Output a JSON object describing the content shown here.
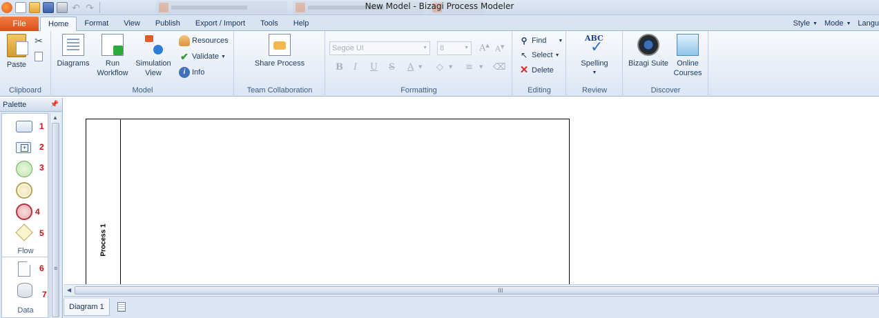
{
  "window": {
    "title": "New Model - Bizagi Process Modeler"
  },
  "menu": {
    "file": "File",
    "tabs": [
      "Home",
      "Format",
      "View",
      "Publish",
      "Export / Import",
      "Tools",
      "Help"
    ],
    "active_tab": "Home",
    "right": [
      "Style",
      "Mode",
      "Langu"
    ]
  },
  "ribbon": {
    "clipboard": {
      "paste": "Paste",
      "label": "Clipboard"
    },
    "model": {
      "diagrams": "Diagrams",
      "run_workflow": "Run\nWorkflow",
      "run": "Run",
      "workflow": "Workflow",
      "simulation": "Simulation",
      "view": "View",
      "resources": "Resources",
      "validate": "Validate",
      "info": "Info",
      "label": "Model"
    },
    "team": {
      "share_process": "Share Process",
      "label": "Team Collaboration"
    },
    "formatting": {
      "font": "Segoe UI",
      "size": "8",
      "label": "Formatting"
    },
    "editing": {
      "find": "Find",
      "select": "Select",
      "delete": "Delete",
      "label": "Editing"
    },
    "review": {
      "spelling": "Spelling",
      "label": "Review"
    },
    "discover": {
      "suite": "Bizagi Suite",
      "online": "Online",
      "courses": "Courses",
      "label": "Discover"
    }
  },
  "palette": {
    "title": "Palette",
    "items": [
      {
        "icon": "task-shape",
        "number": "1"
      },
      {
        "icon": "subprocess-shape",
        "number": "2"
      },
      {
        "icon": "start-event-shape",
        "number": "3"
      },
      {
        "icon": "intermediate-event-shape",
        "number": ""
      },
      {
        "icon": "end-event-shape",
        "number": "4"
      },
      {
        "icon": "gateway-shape",
        "number": "5"
      },
      {
        "icon": "data-object-shape",
        "number": "6"
      },
      {
        "icon": "data-store-shape",
        "number": "7"
      }
    ],
    "sections": {
      "flow": "Flow",
      "data": "Data"
    }
  },
  "canvas": {
    "pool_label": "Process 1"
  },
  "diagram_tabs": {
    "active": "Diagram 1"
  },
  "colors": {
    "file_tab": "#e2571e",
    "ribbon_bg": "#e4ecf7",
    "palette_number": "#d01010"
  }
}
